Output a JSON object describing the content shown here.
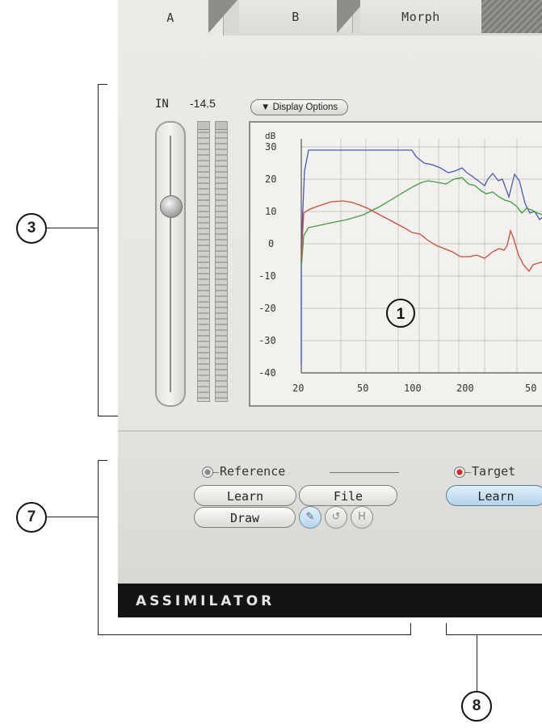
{
  "tabs": [
    {
      "label": "A",
      "active": true
    },
    {
      "label": "B",
      "active": false
    },
    {
      "label": "Morph",
      "active": false
    }
  ],
  "input": {
    "label": "IN",
    "meter_value": "-14.5"
  },
  "display_options": {
    "label": "▼ Display Options"
  },
  "graph": {
    "ylabel": "dB",
    "y_ticks": [
      "30",
      "20",
      "10",
      "0",
      "-10",
      "-20",
      "-30",
      "-40"
    ],
    "x_ticks": [
      "20",
      "50",
      "100",
      "200",
      "50"
    ],
    "series_colors": {
      "blue": "#4b57b5",
      "green": "#3f9f3f",
      "red": "#d04a3c"
    }
  },
  "reference": {
    "label": "Reference",
    "learn": "Learn",
    "file": "File",
    "draw": "Draw"
  },
  "target": {
    "label": "Target",
    "learn": "Learn"
  },
  "icons": {
    "pencil": "pencil-icon",
    "undo": "undo-icon",
    "hold": "hold-icon"
  },
  "footer": {
    "brand": "ASSIMILATOR"
  },
  "callouts": [
    "3",
    "1",
    "7",
    "8"
  ]
}
